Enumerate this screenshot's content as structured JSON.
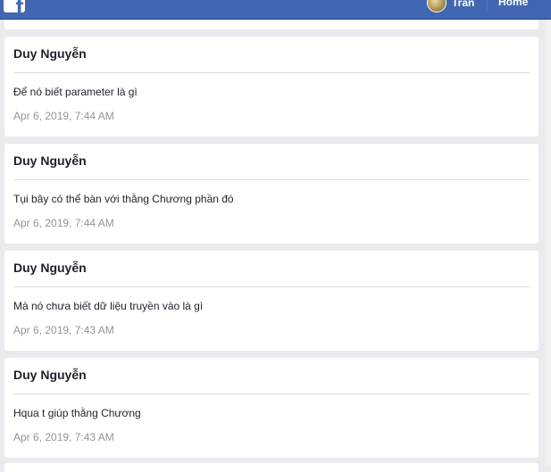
{
  "header": {
    "logo_letter": "f",
    "profile_name": "Tran",
    "home_label": "Home"
  },
  "messages": [
    {
      "author": "Duy Nguyễn",
      "text": "Để nó biết parameter là gì",
      "time": "Apr 6, 2019, 7:44 AM"
    },
    {
      "author": "Duy Nguyễn",
      "text": "Tụi bây có thể bàn với thằng Chương phần đó",
      "time": "Apr 6, 2019, 7:44 AM"
    },
    {
      "author": "Duy Nguyễn",
      "text": "Mà nó chưa biết dữ liệu truyền vào là gì",
      "time": "Apr 6, 2019, 7:43 AM"
    },
    {
      "author": "Duy Nguyễn",
      "text": "Hqua t giúp thằng Chương",
      "time": "Apr 6, 2019, 7:43 AM"
    }
  ]
}
